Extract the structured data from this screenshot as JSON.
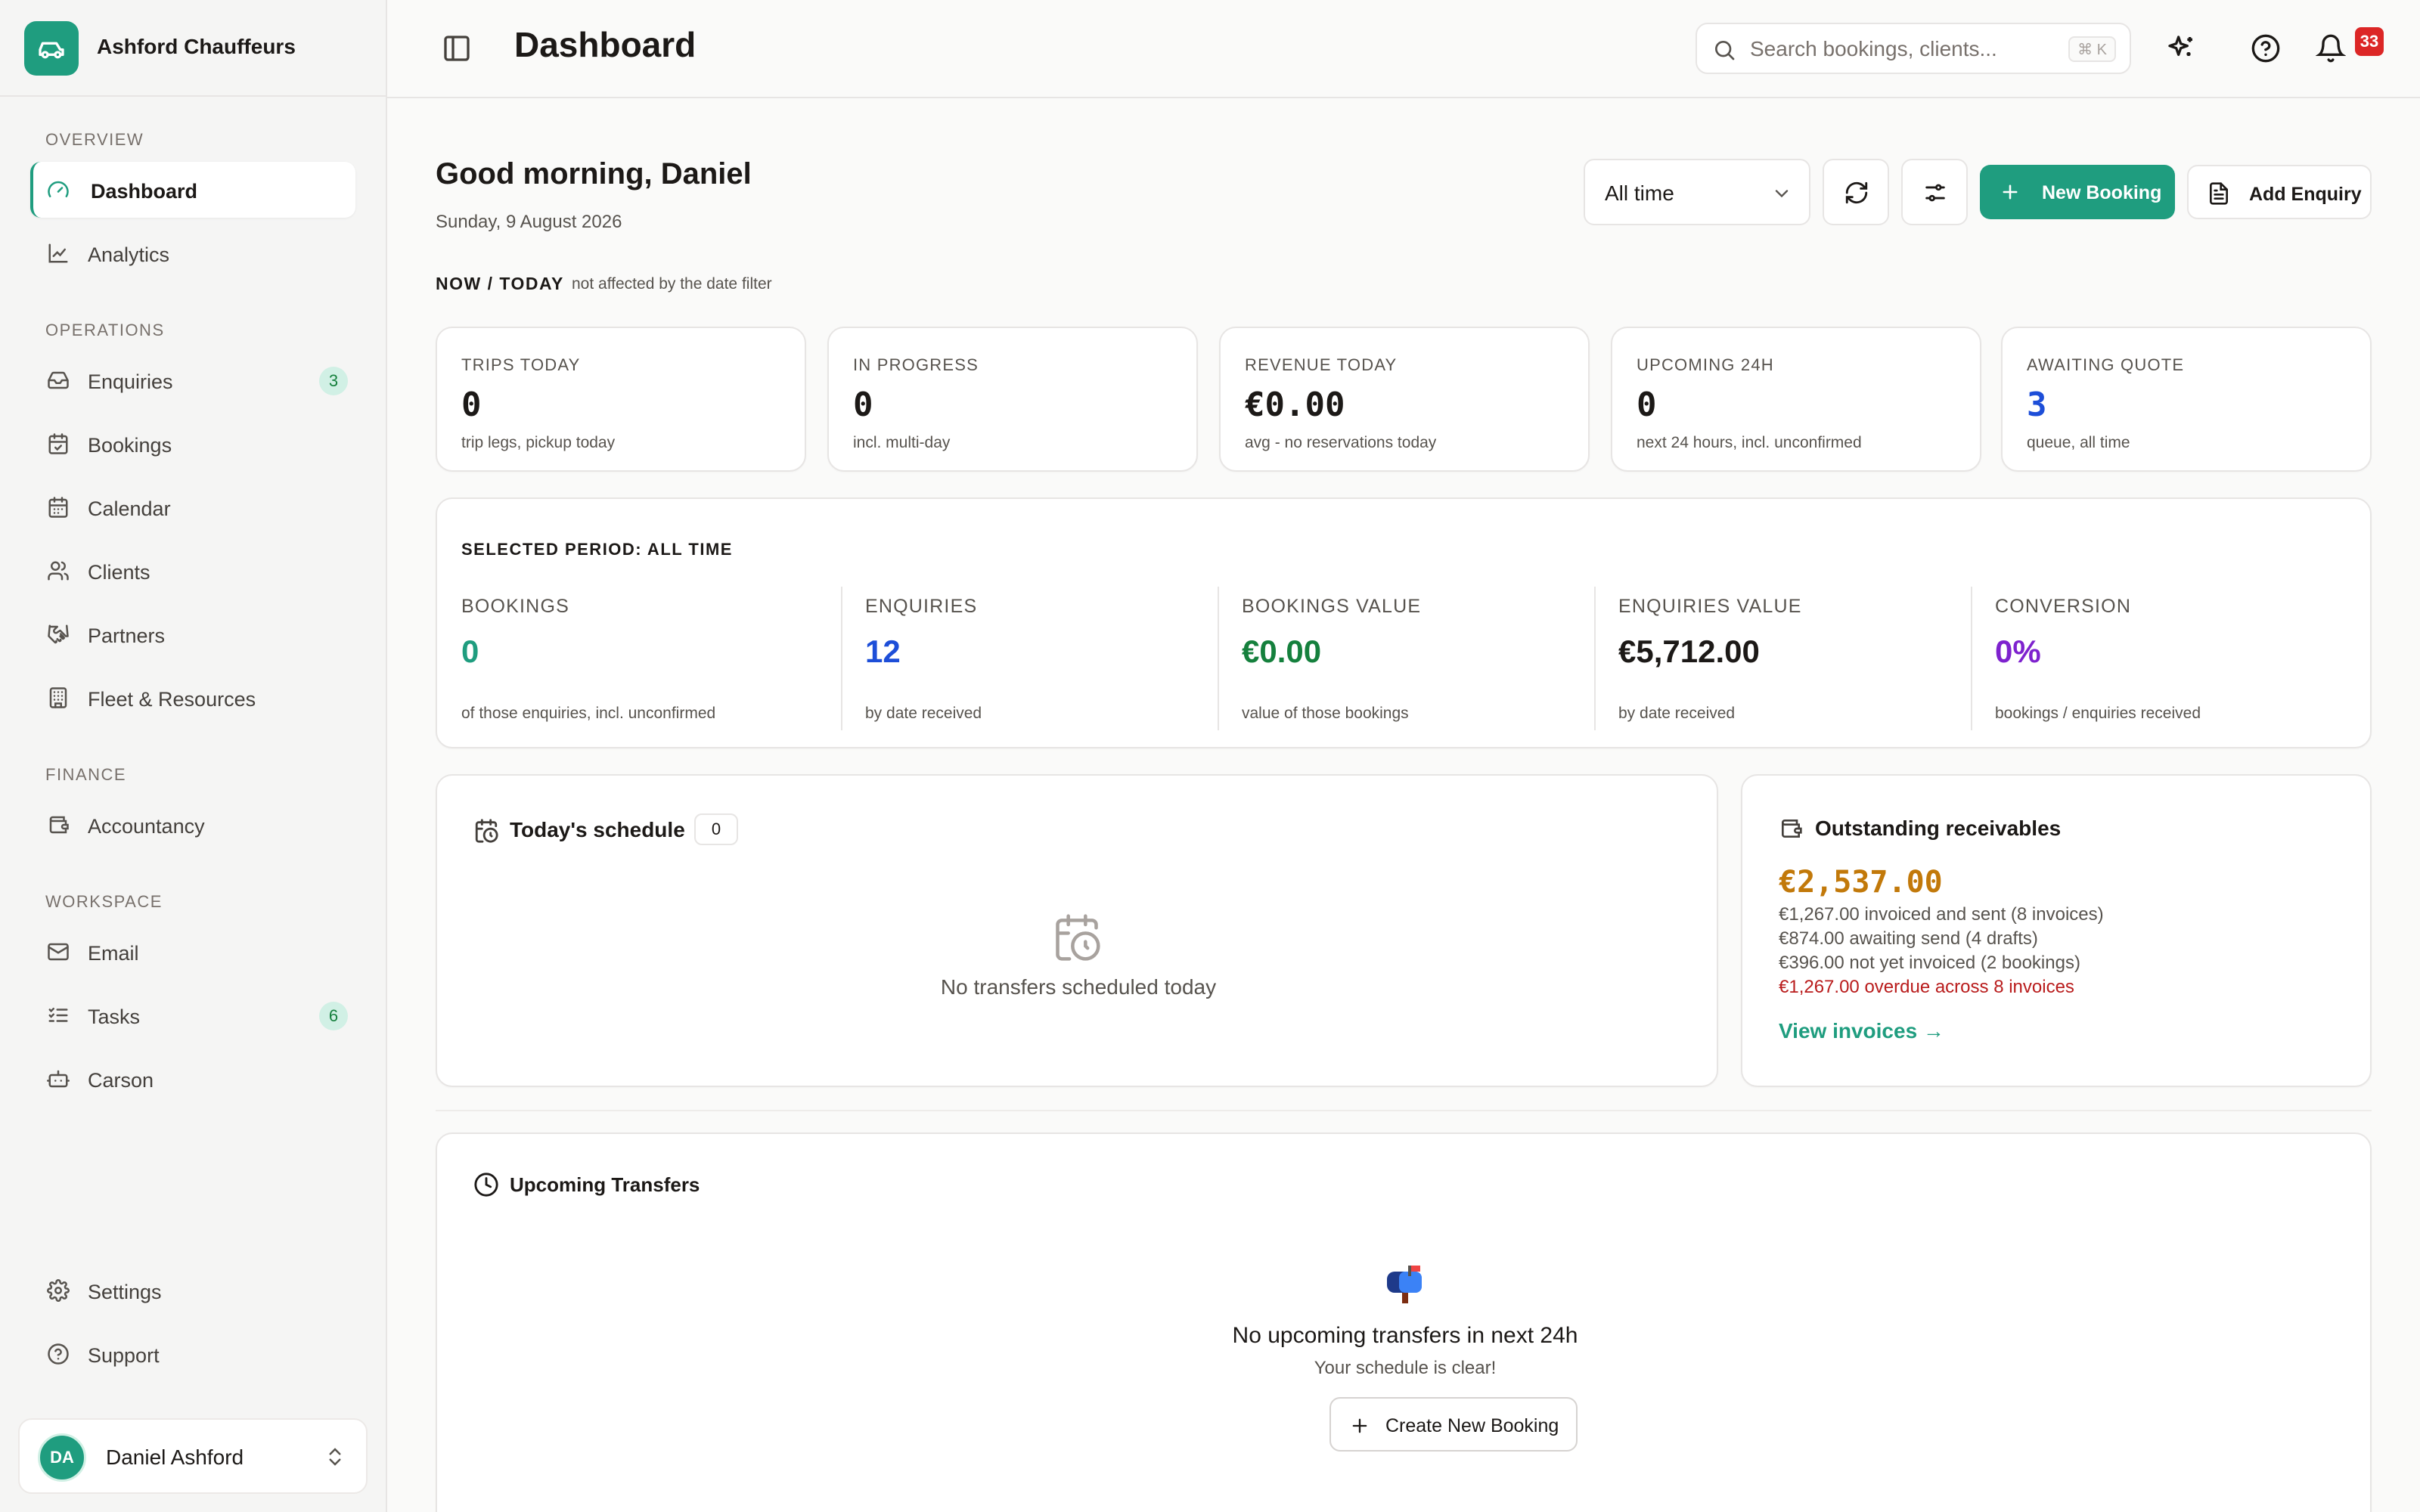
{
  "brand": {
    "name": "Ashford Chauffeurs"
  },
  "sidebar": {
    "sections": {
      "overview": "OVERVIEW",
      "operations": "OPERATIONS",
      "finance": "FINANCE",
      "workspace": "WORKSPACE"
    },
    "items": [
      {
        "label": "Dashboard",
        "icon": "gauge-icon",
        "active": true
      },
      {
        "label": "Analytics",
        "icon": "line-chart-icon"
      },
      {
        "label": "Enquiries",
        "icon": "inbox-icon",
        "badge": "3"
      },
      {
        "label": "Bookings",
        "icon": "calendar-check-icon"
      },
      {
        "label": "Calendar",
        "icon": "calendar-icon"
      },
      {
        "label": "Clients",
        "icon": "users-icon"
      },
      {
        "label": "Partners",
        "icon": "handshake-icon"
      },
      {
        "label": "Fleet & Resources",
        "icon": "building-icon"
      },
      {
        "label": "Accountancy",
        "icon": "wallet-icon"
      },
      {
        "label": "Email",
        "icon": "mail-icon"
      },
      {
        "label": "Tasks",
        "icon": "list-checks-icon",
        "badge": "6"
      },
      {
        "label": "Carson",
        "icon": "bot-icon"
      },
      {
        "label": "Settings",
        "icon": "gear-icon"
      },
      {
        "label": "Support",
        "icon": "help-circle-icon"
      }
    ],
    "user": {
      "initials": "DA",
      "name": "Daniel Ashford"
    }
  },
  "header": {
    "title": "Dashboard",
    "search_placeholder": "Search bookings, clients...",
    "search_shortcut": "⌘ K",
    "notifications_count": "33"
  },
  "greeting": {
    "title": "Good morning, Daniel",
    "date": "Sunday, 9 August 2026"
  },
  "toolbar": {
    "date_filter": "All time",
    "new_booking": "New Booking",
    "add_enquiry": "Add Enquiry"
  },
  "now": {
    "title": "NOW / TODAY",
    "note": "not affected by the date filter",
    "stats": [
      {
        "label": "TRIPS TODAY",
        "value": "0",
        "sub": "trip legs, pickup today"
      },
      {
        "label": "IN PROGRESS",
        "value": "0",
        "sub": "incl. multi-day"
      },
      {
        "label": "REVENUE TODAY",
        "value": "€0.00",
        "sub": "avg - no reservations today"
      },
      {
        "label": "UPCOMING 24H",
        "value": "0",
        "sub": "next 24 hours, incl. unconfirmed"
      },
      {
        "label": "AWAITING QUOTE",
        "value": "3",
        "sub": "queue, all time"
      }
    ]
  },
  "period": {
    "title": "SELECTED PERIOD: ALL TIME",
    "metrics": [
      {
        "label": "BOOKINGS",
        "value": "0",
        "sub": "of those enquiries, incl. unconfirmed",
        "color": "#1f9d7f"
      },
      {
        "label": "ENQUIRIES",
        "value": "12",
        "sub": "by date received",
        "color": "#1d4ed8"
      },
      {
        "label": "BOOKINGS VALUE",
        "value": "€0.00",
        "sub": "value of those bookings",
        "color": "#15803d"
      },
      {
        "label": "ENQUIRIES VALUE",
        "value": "€5,712.00",
        "sub": "by date received",
        "color": "#1c1917"
      },
      {
        "label": "CONVERSION",
        "value": "0%",
        "sub": "bookings / enquiries received",
        "color": "#7e22ce"
      }
    ]
  },
  "schedule": {
    "title": "Today's schedule",
    "count": "0",
    "empty": "No transfers scheduled today"
  },
  "receivables": {
    "title": "Outstanding receivables",
    "amount": "€2,537.00",
    "lines": [
      "€1,267.00 invoiced and sent (8 invoices)",
      "€874.00 awaiting send (4 drafts)",
      "€396.00 not yet invoiced (2 bookings)"
    ],
    "overdue": "€1,267.00 overdue across 8 invoices",
    "link": "View invoices →"
  },
  "upcoming": {
    "title": "Upcoming Transfers",
    "empty_title": "No upcoming transfers in next 24h",
    "empty_sub": "Your schedule is clear!",
    "cta": "Create New Booking"
  },
  "colors": {
    "accent": "#1f9d7f",
    "awaiting_quote": "#1d4ed8",
    "receivables": "#c2790a",
    "overdue": "#b91c1c",
    "notification": "#dc2626"
  }
}
